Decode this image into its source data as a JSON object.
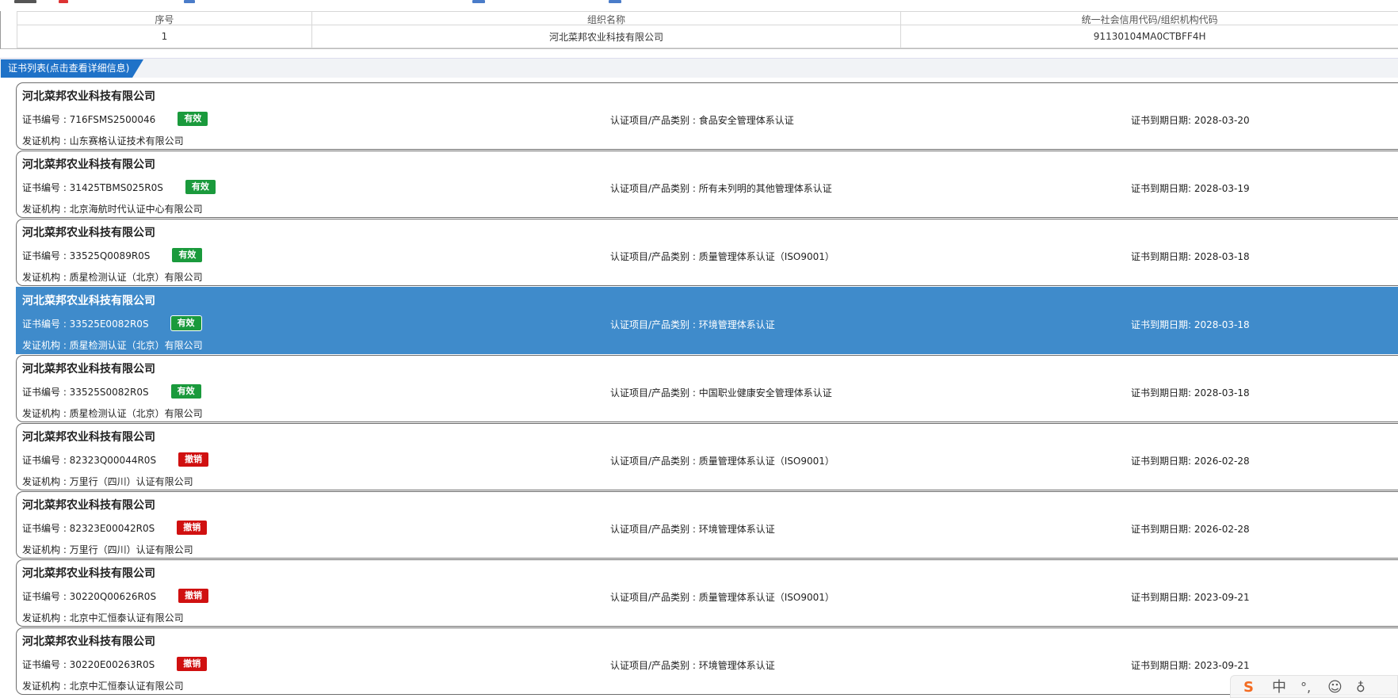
{
  "org_table": {
    "headers": [
      "序号",
      "组织名称",
      "统一社会信用代码/组织机构代码"
    ],
    "row": {
      "index": "1",
      "name": "河北菜邦农业科技有限公司",
      "code": "91130104MA0CTBFF4H"
    }
  },
  "cert_section": {
    "title": "证书列表(点击查看详细信息)"
  },
  "certificates": [
    {
      "company": "河北菜邦农业科技有限公司",
      "number": "证书编号 : 716FSMS2500046",
      "status": "有效",
      "status_type": "valid",
      "category": "认证项目/产品类别 : 食品安全管理体系认证",
      "expiry": "证书到期日期: 2028-03-20",
      "issuer": "发证机构 : 山东赛格认证技术有限公司"
    },
    {
      "company": "河北菜邦农业科技有限公司",
      "number": "证书编号 : 31425TBMS025R0S",
      "status": "有效",
      "status_type": "valid",
      "category": "认证项目/产品类别 : 所有未列明的其他管理体系认证",
      "expiry": "证书到期日期: 2028-03-19",
      "issuer": "发证机构 : 北京海航时代认证中心有限公司"
    },
    {
      "company": "河北菜邦农业科技有限公司",
      "number": "证书编号 : 33525Q0089R0S",
      "status": "有效",
      "status_type": "valid",
      "category": "认证项目/产品类别 : 质量管理体系认证（ISO9001）",
      "expiry": "证书到期日期: 2028-03-18",
      "issuer": "发证机构 : 质星检测认证（北京）有限公司"
    },
    {
      "company": "河北菜邦农业科技有限公司",
      "number": "证书编号 : 33525E0082R0S",
      "status": "有效",
      "status_type": "valid",
      "category": "认证项目/产品类别 : 环境管理体系认证",
      "expiry": "证书到期日期: 2028-03-18",
      "issuer": "发证机构 : 质星检测认证（北京）有限公司",
      "selected": true
    },
    {
      "company": "河北菜邦农业科技有限公司",
      "number": "证书编号 : 33525S0082R0S",
      "status": "有效",
      "status_type": "valid",
      "category": "认证项目/产品类别 : 中国职业健康安全管理体系认证",
      "expiry": "证书到期日期: 2028-03-18",
      "issuer": "发证机构 : 质星检测认证（北京）有限公司"
    },
    {
      "company": "河北菜邦农业科技有限公司",
      "number": "证书编号 : 82323Q00044R0S",
      "status": "撤销",
      "status_type": "revoked",
      "category": "认证项目/产品类别 : 质量管理体系认证（ISO9001）",
      "expiry": "证书到期日期: 2026-02-28",
      "issuer": "发证机构 : 万里行（四川）认证有限公司"
    },
    {
      "company": "河北菜邦农业科技有限公司",
      "number": "证书编号 : 82323E00042R0S",
      "status": "撤销",
      "status_type": "revoked",
      "category": "认证项目/产品类别 : 环境管理体系认证",
      "expiry": "证书到期日期: 2026-02-28",
      "issuer": "发证机构 : 万里行（四川）认证有限公司"
    },
    {
      "company": "河北菜邦农业科技有限公司",
      "number": "证书编号 : 30220Q00626R0S",
      "status": "撤销",
      "status_type": "revoked",
      "category": "认证项目/产品类别 : 质量管理体系认证（ISO9001）",
      "expiry": "证书到期日期: 2023-09-21",
      "issuer": "发证机构 : 北京中汇恒泰认证有限公司"
    },
    {
      "company": "河北菜邦农业科技有限公司",
      "number": "证书编号 : 30220E00263R0S",
      "status": "撤销",
      "status_type": "revoked",
      "category": "认证项目/产品类别 : 环境管理体系认证",
      "expiry": "证书到期日期: 2023-09-21",
      "issuer": "发证机构 : 北京中汇恒泰认证有限公司"
    }
  ],
  "ime": {
    "logo": "S",
    "mode": "中"
  },
  "colors": {
    "accent": "#1f72c8",
    "selected_row": "#3f8bcb",
    "valid": "#1a9a3c",
    "revoked": "#d01010"
  }
}
